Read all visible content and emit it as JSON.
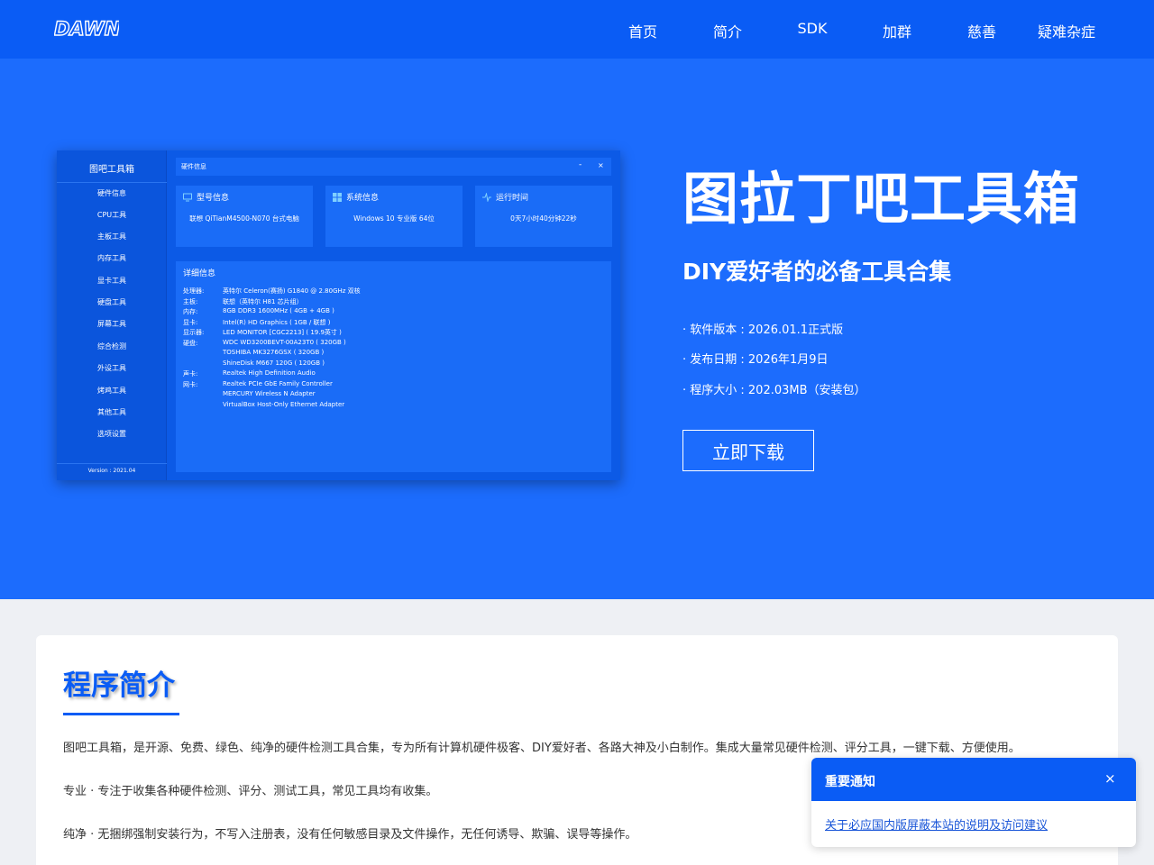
{
  "brand": {
    "logo_text": "DAWN"
  },
  "nav": {
    "items": [
      "首页",
      "简介",
      "SDK",
      "加群",
      "慈善",
      "疑难杂症"
    ]
  },
  "hero": {
    "title": "图拉丁吧工具箱",
    "subtitle": "DIY爱好者的必备工具合集",
    "meta": [
      "· 软件版本 : 2026.01.1正式版",
      "· 发布日期 : 2026年1月9日",
      "· 程序大小 : 202.03MB（安装包）"
    ],
    "download_label": "立即下载"
  },
  "app_preview": {
    "sidebar_title": "图吧工具箱",
    "sidebar_items": [
      "硬件信息",
      "CPU工具",
      "主板工具",
      "内存工具",
      "显卡工具",
      "硬盘工具",
      "屏幕工具",
      "综合检测",
      "外设工具",
      "烤鸡工具",
      "其他工具",
      "选项设置"
    ],
    "version": "Version : 2021.04",
    "window_title": "硬件信息",
    "window_minimize": "-",
    "window_close": "×",
    "cards": [
      {
        "title": "型号信息",
        "value": "联想 QiTianM4500-N070 台式电脑",
        "icon": "monitor-icon"
      },
      {
        "title": "系统信息",
        "value": "Windows 10 专业版 64位",
        "icon": "windows-icon"
      },
      {
        "title": "运行时间",
        "value": "0天7小时40分钟22秒",
        "icon": "pulse-icon"
      }
    ],
    "detail_title": "详细信息",
    "detail_rows": [
      {
        "k": "处理器:",
        "v": "英特尔 Celeron(赛扬) G1840 @ 2.80GHz 双核"
      },
      {
        "k": "主板:",
        "v": "联想（英特尔 H81 芯片组）"
      },
      {
        "k": "内存:",
        "v": "8GB DDR3 1600MHz ( 4GB + 4GB )"
      },
      {
        "k": "显卡:",
        "v": "Intel(R) HD Graphics ( 1GB / 联想 )"
      },
      {
        "k": "显示器:",
        "v": "LED MONITOR [CGC2213] ( 19.9英寸 )"
      },
      {
        "k": "硬盘:",
        "v": "WDC WD3200BEVT-00A23T0 ( 320GB )"
      },
      {
        "k": "",
        "v": "TOSHIBA MK3276GSX ( 320GB )"
      },
      {
        "k": "",
        "v": "ShineDisk M667 120G ( 120GB )"
      },
      {
        "k": "声卡:",
        "v": "Realtek High Definition Audio"
      },
      {
        "k": "网卡:",
        "v": "Realtek PCIe GbE Family Controller"
      },
      {
        "k": "",
        "v": "MERCURY Wireless N Adapter"
      },
      {
        "k": "",
        "v": "VirtualBox Host-Only Ethernet Adapter"
      }
    ]
  },
  "intro": {
    "title": "程序简介",
    "paragraphs": [
      "图吧工具箱，是开源、免费、绿色、纯净的硬件检测工具合集，专为所有计算机硬件极客、DIY爱好者、各路大神及小白制作。集成大量常见硬件检测、评分工具，一键下载、方便使用。",
      "专业 · 专注于收集各种硬件检测、评分、测试工具，常见工具均有收集。",
      "纯净 · 无捆绑强制安装行为，不写入注册表，没有任何敏感目录及文件操作，无任何诱导、欺骗、误导等操作。"
    ]
  },
  "notice": {
    "title": "重要通知",
    "close": "×",
    "link": "关于必应国内版屏蔽本站的说明及访问建议"
  },
  "colors": {
    "nav": "#0a5cf5",
    "hero": "#1c6cfd",
    "accent": "#0a5cf5"
  }
}
